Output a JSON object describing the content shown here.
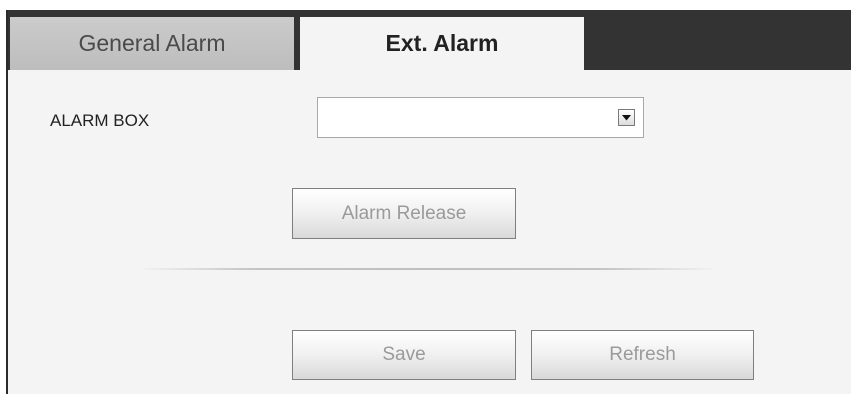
{
  "tabs": {
    "general_alarm": "General Alarm",
    "ext_alarm": "Ext. Alarm",
    "active": "Ext. Alarm"
  },
  "form": {
    "alarm_box_label": "ALARM BOX",
    "alarm_box_value": ""
  },
  "buttons": {
    "alarm_release": "Alarm Release",
    "save": "Save",
    "refresh": "Refresh"
  },
  "icons": {
    "dropdown": "chevron-down-icon"
  },
  "colors": {
    "tabbar_bg": "#333333",
    "panel_bg": "#f4f4f4",
    "inactive_tab_bg": "#c4c4c4",
    "button_text_disabled": "#9a9a9a"
  }
}
